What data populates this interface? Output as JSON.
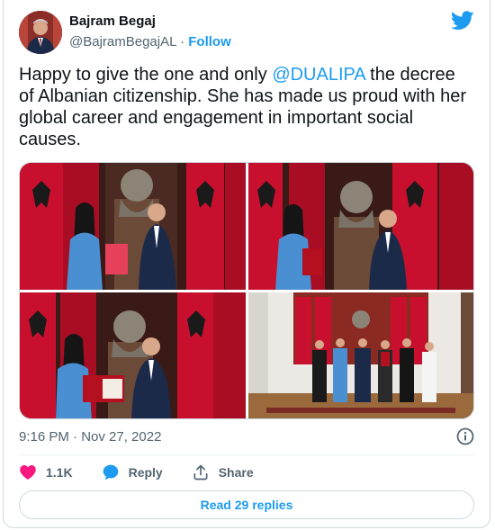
{
  "author": {
    "name": "Bajram Begaj",
    "handle": "@BajramBegajAL",
    "separator": "·",
    "follow_label": "Follow"
  },
  "tweet": {
    "text_before": "Happy to give the one and only ",
    "mention": "@DUALIPA",
    "text_after": " the decree of Albanian citizenship. She has made us proud with her global career and engagement in important social causes."
  },
  "media": {
    "photos": [
      {
        "name": "decree-handover-photo-1"
      },
      {
        "name": "decree-handover-photo-2"
      },
      {
        "name": "decree-handover-photo-3"
      },
      {
        "name": "group-photo-4"
      }
    ]
  },
  "timestamp": "9:16 PM · Nov 27, 2022",
  "actions": {
    "likes": "1.1K",
    "reply_label": "Reply",
    "share_label": "Share"
  },
  "read_replies_label": "Read 29 replies",
  "colors": {
    "accent": "#1d9bf0",
    "like": "#f91880",
    "flag_red": "#c8102e",
    "secondary_text": "#536471"
  },
  "icons": [
    "twitter-bird-icon",
    "info-icon",
    "heart-icon",
    "reply-bubble-icon",
    "share-icon"
  ]
}
